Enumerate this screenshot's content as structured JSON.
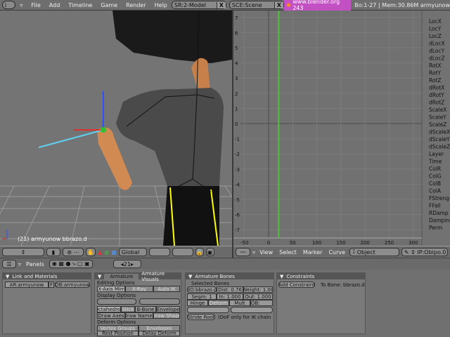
{
  "topbar": {
    "menus": [
      "File",
      "Add",
      "Timeline",
      "Game",
      "Render",
      "Help"
    ],
    "screen": "SR:2-Model",
    "scene": "SCE:Scene",
    "splash": "www.blender.org 243",
    "stats": "Bo:1-27  | Mem:30.86M armyunow"
  },
  "view3d": {
    "status": "(21) armyunow bbrazo.d",
    "header": {
      "orientation": "Global"
    }
  },
  "ipo": {
    "y_ticks": [
      "7",
      "6",
      "5",
      "4",
      "3",
      "2",
      "1",
      "0",
      "-1",
      "-2",
      "-3",
      "-4",
      "-5",
      "-6",
      "-7"
    ],
    "x_ticks": [
      "-50",
      "0",
      "50",
      "100",
      "150",
      "200",
      "250",
      "300"
    ],
    "current_frame": 21,
    "channels": [
      "LocX",
      "LocY",
      "LocZ",
      "dLocX",
      "dLocY",
      "dLocZ",
      "RotX",
      "RotY",
      "RotZ",
      "dRotX",
      "dRotY",
      "dRotZ",
      "ScaleX",
      "ScaleY",
      "ScaleZ",
      "dScaleX",
      "dScaleY",
      "dScaleZ",
      "Layer",
      "Time",
      "ColR",
      "ColG",
      "ColB",
      "ColA",
      "FStreng",
      "FFall",
      "RDamp",
      "Damping",
      "Perm"
    ],
    "header": {
      "menus": [
        "View",
        "Select",
        "Marker",
        "Curve"
      ],
      "type": "Object",
      "block": "IP:Obipo.0"
    },
    "green": "#4fc040"
  },
  "buttons": {
    "header": {
      "panels": "Panels",
      "frame": "21"
    },
    "link": {
      "title": "Link and Materials",
      "ar": "AR:armyunow",
      "f": "F",
      "ob": "OB:armyunow"
    },
    "armature": {
      "tab1": "Armature",
      "tab2": "Armature Visuals",
      "editing": "Editing Options",
      "xmirr": "X-Axis Mirr",
      "xray": "X-Ray",
      "autoik": "Auto IK",
      "display": "Display Options",
      "octa": "Octahedron",
      "stick": "Stick",
      "bbone": "B-Bone",
      "envelope": "Envelope",
      "axes": "Draw Axes",
      "names": "Draw Names",
      "shape": "Draw Shape",
      "deform": "Deform Options",
      "vgroups": "Vertex Groups",
      "envelopes": "Envelopes",
      "rest": "Rest Position",
      "delay": "Delay Deform"
    },
    "bones": {
      "title": "Armature Bones",
      "selected": "Selected Bones",
      "bo": "BO:bbrazo.d",
      "dist": "Dist: 0.76",
      "weight": "Weight: 1.00",
      "segm": "Segm: 1",
      "in": "In: 1.000",
      "out": "Out: 1.000",
      "hinge": "Hinge",
      "deform": "Deform",
      "mult": "Mult",
      "ob": "OB:",
      "stride": "Stride Root",
      "dof": "(DoF only for IK chain"
    },
    "constraints": {
      "title": "Constraints",
      "add": "Add Constraint",
      "to": "To Bone: bbrazo.d"
    }
  }
}
